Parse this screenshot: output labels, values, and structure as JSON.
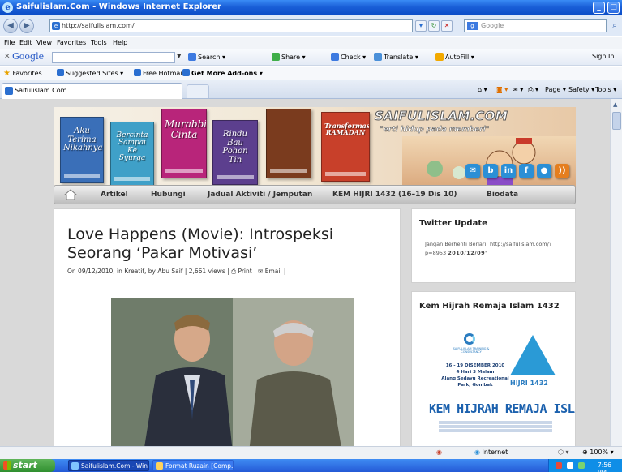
{
  "window": {
    "title": "Saifulislam.Com - Windows Internet Explorer"
  },
  "address_bar": {
    "url": "http://saifulislam.com/",
    "search_placeholder": "Google"
  },
  "menu": [
    "File",
    "Edit",
    "View",
    "Favorites",
    "Tools",
    "Help"
  ],
  "google_toolbar": {
    "logo": "Google",
    "items": [
      "Search",
      "Share",
      "Check",
      "Translate",
      "AutoFill"
    ],
    "sign_in": "Sign In"
  },
  "favorites_bar": {
    "label": "Favorites",
    "items": [
      "Suggested Sites",
      "Free Hotmail",
      "Get More Add-ons"
    ]
  },
  "tab": {
    "label": "Saifulislam.Com"
  },
  "command_bar": [
    "Page",
    "Safety",
    "Tools"
  ],
  "site": {
    "logo": "SAIFULISLAM.COM",
    "tagline": "\"erti hidup pada memberi\"",
    "books": [
      {
        "title": "Aku Terima Nikahnya",
        "color": "#3a6fb8"
      },
      {
        "title": "Bercinta Sampai Ke Syurga",
        "color": "#3fa0c8"
      },
      {
        "title": "Murabbi Cinta",
        "color": "#b8257a"
      },
      {
        "title": "Rindu Bau Pohon Tin",
        "color": "#5c3f8e"
      },
      {
        "title": "",
        "color": "#7a3b1e"
      },
      {
        "title": "Transformasi RAMADAN",
        "color": "#c8402a"
      }
    ],
    "social": [
      "email",
      "b",
      "in",
      "f",
      "chat",
      "rss"
    ]
  },
  "nav": {
    "items": [
      "Artikel",
      "Hubungi",
      "Jadual Aktiviti / Jemputan",
      "KEM HIJRI 1432 (16–19 Dis 10)",
      "Biodata"
    ]
  },
  "post": {
    "title": "Love Happens (Movie): Introspeksi Seorang ‘Pakar Motivasi’",
    "meta_prefix": "On 09/12/2010, in Kreatif, by Abu Saif | 2,661 views |",
    "print": "Print",
    "email": "Email"
  },
  "sidebar": {
    "twitter": {
      "title": "Twitter Update",
      "tweet_text": "Jangan Berhenti Berlari! http://saifulislam.com/?p=8953",
      "tweet_date": "2010/12/09'"
    },
    "kem": {
      "title": "Kem Hijrah Remaja Islam 1432",
      "poster_org": "SAIFULISLAM TRAINING & CONSULTANCY",
      "poster_dates": "16 - 19 DISEMBER 2010",
      "poster_duration": "4 Hari 3 Malam",
      "poster_place": "Alang Sedayu Recreational Park, Gombak",
      "poster_hijri": "HIJRI 1432",
      "poster_heading": "KEM HIJRAH REMAJA ISLAM"
    }
  },
  "status_bar": {
    "zone": "Internet",
    "zoom": "100%"
  },
  "taskbar": {
    "start": "start",
    "tasks": [
      "Saifulislam.Com - Win...",
      "Format Ruzain [Comp..."
    ],
    "time": "7:56 PM"
  },
  "colors": {
    "titlebar": "#1a5fd8",
    "page_bg": "#d9d9d9",
    "nav_bg": "#cfcfcf"
  }
}
